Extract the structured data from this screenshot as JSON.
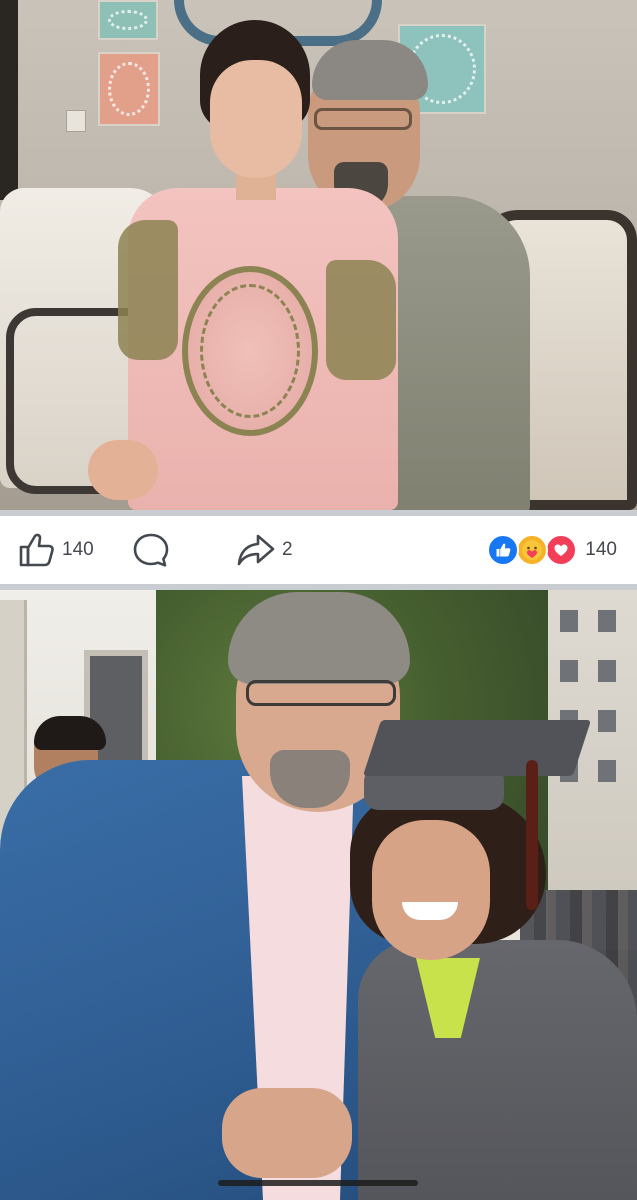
{
  "post": {
    "likes_count": "140",
    "shares_count": "2",
    "reactions_total": "140",
    "reaction_types": [
      "like",
      "care",
      "love"
    ]
  },
  "colors": {
    "like_blue": "#1877f2",
    "care_yellow": "#f7b125",
    "love_red": "#f33e58",
    "action_text": "#444950",
    "divider": "#c9ccd1"
  },
  "icons": {
    "like": "thumbs-up-outline-icon",
    "comment": "speech-bubble-outline-icon",
    "share": "share-arrow-outline-icon"
  }
}
